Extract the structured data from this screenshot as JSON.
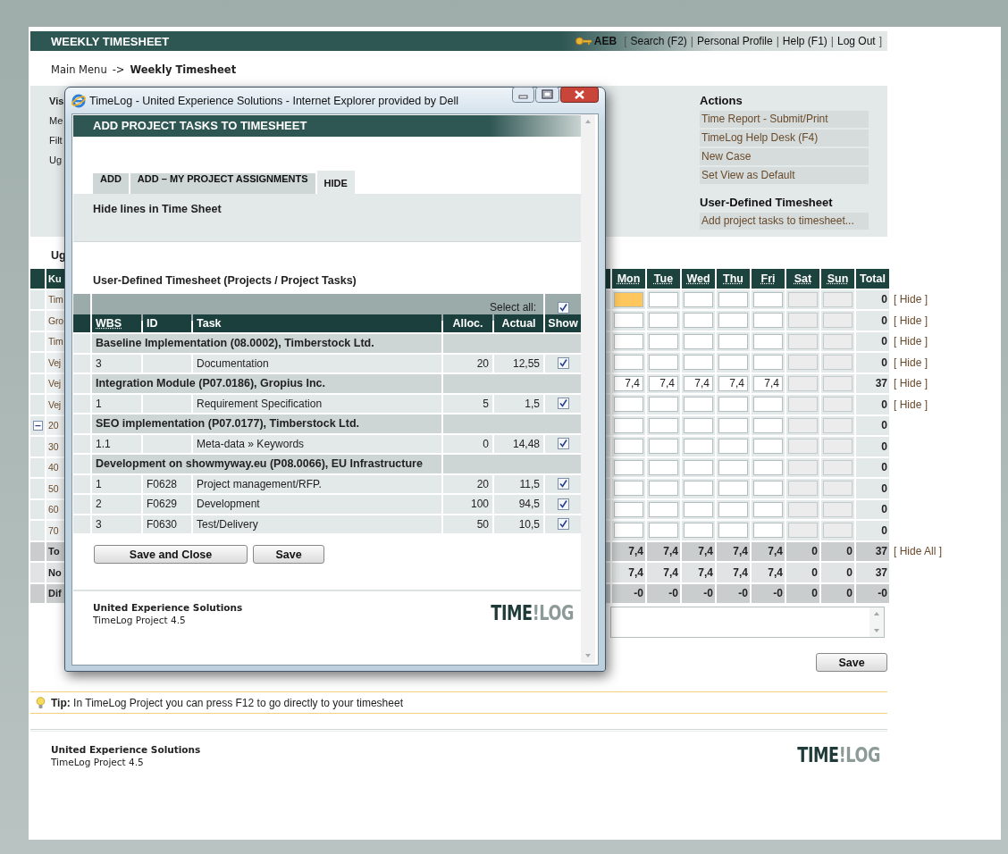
{
  "topbar": {
    "title": "WEEKLY TIMESHEET",
    "user": "AEB",
    "nav": [
      {
        "kind": "punct",
        "text": "["
      },
      {
        "kind": "link",
        "text": "Search (F2)"
      },
      {
        "kind": "punct",
        "text": "|"
      },
      {
        "kind": "link",
        "text": "Personal Profile"
      },
      {
        "kind": "punct",
        "text": "|"
      },
      {
        "kind": "link",
        "text": "Help (F1)"
      },
      {
        "kind": "punct",
        "text": "|"
      },
      {
        "kind": "link",
        "text": "Log Out"
      },
      {
        "kind": "punct",
        "text": "]"
      }
    ]
  },
  "breadcrumb": {
    "link": "Main Menu",
    "separator": "->",
    "current": "Weekly Timesheet"
  },
  "options_panel": {
    "labels": [
      {
        "kind": "heading",
        "text": "Vis"
      },
      {
        "kind": "plain",
        "text": "Me"
      },
      {
        "kind": "plain",
        "text": "Filt"
      },
      {
        "kind": "plain",
        "text": "Ug"
      }
    ],
    "actions_title": "Actions",
    "actions": [
      "Time Report - Submit/Print",
      "TimeLog Help Desk (F4)",
      "New Case",
      "Set View as Default"
    ],
    "user_defined_title": "User-Defined Timesheet",
    "user_defined_links": [
      "Add project tasks to timesheet..."
    ]
  },
  "week_label": "Ug",
  "sheet": {
    "columns": [
      {
        "kind": "label",
        "label": "Ku"
      },
      {
        "kind": "weekday",
        "label": "Mon"
      },
      {
        "kind": "weekday",
        "label": "Tue"
      },
      {
        "kind": "weekday",
        "label": "Wed"
      },
      {
        "kind": "weekday",
        "label": "Thu"
      },
      {
        "kind": "weekday",
        "label": "Fri"
      },
      {
        "kind": "weekend",
        "label": "Sat"
      },
      {
        "kind": "weekend",
        "label": "Sun"
      },
      {
        "kind": "total",
        "label": "Total"
      }
    ],
    "rows": [
      {
        "kind": "task",
        "focused": true,
        "cells": [
          "Tim",
          "",
          "",
          "",
          "",
          "",
          "",
          "",
          "0"
        ],
        "hide": "[ Hide ]"
      },
      {
        "kind": "task",
        "focused": false,
        "cells": [
          "Gro",
          "",
          "",
          "",
          "",
          "",
          "",
          "",
          "0"
        ],
        "hide": "[ Hide ]"
      },
      {
        "kind": "task",
        "focused": false,
        "cells": [
          "Tim",
          "",
          "",
          "",
          "",
          "",
          "",
          "",
          "0"
        ],
        "hide": "[ Hide ]"
      },
      {
        "kind": "task",
        "focused": false,
        "cells": [
          "Vej",
          "",
          "",
          "",
          "",
          "",
          "",
          "",
          "0"
        ],
        "hide": "[ Hide ]"
      },
      {
        "kind": "task",
        "focused": false,
        "cells": [
          "Vej",
          "7,4",
          "7,4",
          "7,4",
          "7,4",
          "7,4",
          "",
          "",
          "37"
        ],
        "hide": "[ Hide ]"
      },
      {
        "kind": "task",
        "focused": false,
        "cells": [
          "Vej",
          "",
          "",
          "",
          "",
          "",
          "",
          "",
          "0"
        ],
        "hide": "[ Hide ]"
      },
      {
        "kind": "group",
        "expanded": true,
        "focused": false,
        "cells": [
          "20",
          "",
          "",
          "",
          "",
          "",
          "",
          "",
          "0"
        ]
      },
      {
        "kind": "task",
        "focused": false,
        "cells": [
          "30",
          "",
          "",
          "",
          "",
          "",
          "",
          "",
          "0"
        ]
      },
      {
        "kind": "task",
        "focused": false,
        "cells": [
          "40",
          "",
          "",
          "",
          "",
          "",
          "",
          "",
          "0"
        ]
      },
      {
        "kind": "task",
        "focused": false,
        "cells": [
          "50",
          "",
          "",
          "",
          "",
          "",
          "",
          "",
          "0"
        ]
      },
      {
        "kind": "task",
        "focused": false,
        "cells": [
          "60",
          "",
          "",
          "",
          "",
          "",
          "",
          "",
          "0"
        ]
      },
      {
        "kind": "task",
        "focused": false,
        "cells": [
          "70",
          "",
          "",
          "",
          "",
          "",
          "",
          "",
          "0"
        ]
      }
    ],
    "summary": [
      {
        "cells": [
          "To",
          "7,4",
          "7,4",
          "7,4",
          "7,4",
          "7,4",
          "0",
          "0",
          "37"
        ],
        "hide": "[ Hide All ]"
      },
      {
        "cells": [
          "No",
          "7,4",
          "7,4",
          "7,4",
          "7,4",
          "7,4",
          "0",
          "0",
          "37"
        ]
      },
      {
        "cells": [
          "Dif",
          "-0",
          "-0",
          "-0",
          "-0",
          "-0",
          "0",
          "0",
          "-0"
        ]
      }
    ]
  },
  "save_button": "Save",
  "tip": "**Tip:** In TimeLog Project you can press F12 to go directly to your timesheet",
  "footer": {
    "company": "United Experience Solutions",
    "product": "TimeLog Project 4.5",
    "logo": [
      "TIME",
      "!LOG"
    ]
  },
  "popup": {
    "window_title": "TimeLog - United Experience Solutions - Internet Explorer provided by Dell",
    "heading": "ADD PROJECT TASKS TO TIMESHEET",
    "tabs": [
      {
        "label": "ADD",
        "selected": false
      },
      {
        "label": "ADD – MY PROJECT ASSIGNMENTS",
        "selected": false
      },
      {
        "label": "HIDE",
        "selected": true
      }
    ],
    "panel_title": "Hide lines in Time Sheet",
    "section_title": "User-Defined Timesheet (Projects / Project Tasks)",
    "select_all": {
      "label": "Select all:",
      "checked": true
    },
    "columns": [
      "WBS",
      "ID",
      "Task",
      "Alloc.",
      "Actual",
      "Show"
    ],
    "projects": [
      {
        "name": "Baseline Implementation (08.0002), Timberstock Ltd.",
        "tasks": [
          {
            "wbs": "3",
            "task": "Documentation",
            "alloc": "20",
            "actual": "12,55",
            "show": true
          }
        ]
      },
      {
        "name": "Integration Module (P07.0186), Gropius Inc.",
        "tasks": [
          {
            "wbs": "1",
            "task": "Requirement Specification",
            "alloc": "5",
            "actual": "1,5",
            "show": true
          }
        ]
      },
      {
        "name": "SEO implementation (P07.0177), Timberstock Ltd.",
        "tasks": [
          {
            "wbs": "1.1",
            "task": "Meta-data » Keywords",
            "alloc": "0",
            "actual": "14,48",
            "show": true
          }
        ]
      },
      {
        "name": "Development on showmyway.eu (P08.0066), EU Infrastructure",
        "tasks": [
          {
            "wbs": "1",
            "id": "F0628",
            "task": "Project management/RFP.",
            "alloc": "20",
            "actual": "11,5",
            "show": true
          },
          {
            "wbs": "2",
            "id": "F0629",
            "task": "Development",
            "alloc": "100",
            "actual": "94,5",
            "show": true
          },
          {
            "wbs": "3",
            "id": "F0630",
            "task": "Test/Delivery",
            "alloc": "50",
            "actual": "10,5",
            "show": true
          }
        ]
      }
    ],
    "buttons": [
      "Save and Close",
      "Save"
    ],
    "footer": {
      "company": "United Experience Solutions",
      "product": "TimeLog Project 4.5",
      "logo": [
        "TIME",
        "!LOG"
      ]
    }
  }
}
